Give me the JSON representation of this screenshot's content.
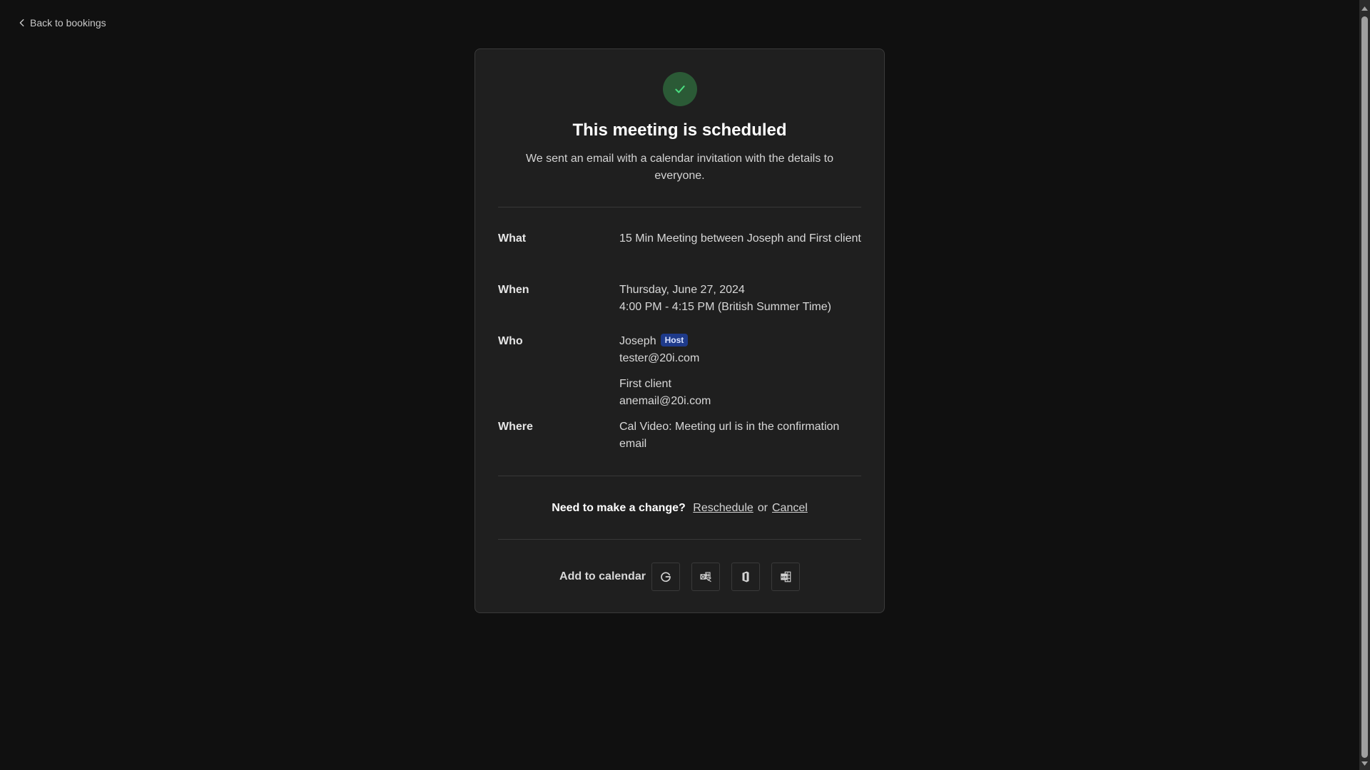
{
  "nav": {
    "back_label": "Back to bookings"
  },
  "card": {
    "status_icon": "check-icon",
    "title": "This meeting is scheduled",
    "subtitle": "We sent an email with a calendar invitation with the details to everyone.",
    "details": {
      "what": {
        "label": "What",
        "value": "15 Min Meeting between Joseph and First client"
      },
      "when": {
        "label": "When",
        "date": "Thursday, June 27, 2024",
        "time": "4:00 PM - 4:15 PM (British Summer Time)"
      },
      "who": {
        "label": "Who",
        "host": {
          "name": "Joseph",
          "badge": "Host",
          "email": "tester@20i.com"
        },
        "attendee": {
          "name": "First client",
          "email": "anemail@20i.com"
        }
      },
      "where": {
        "label": "Where",
        "value": "Cal Video: Meeting url is in the confirmation email"
      }
    },
    "change": {
      "question": "Need to make a change?",
      "reschedule": "Reschedule",
      "or": "or",
      "cancel": "Cancel"
    },
    "add_to_calendar": {
      "label": "Add to calendar",
      "buttons": [
        {
          "name": "Google Calendar",
          "icon": "google-icon"
        },
        {
          "name": "Outlook",
          "icon": "outlook-icon"
        },
        {
          "name": "Office 365",
          "icon": "office-icon"
        },
        {
          "name": "ICS download",
          "icon": "ics-file-icon"
        }
      ]
    }
  },
  "colors": {
    "page_bg": "#101010",
    "card_bg": "#1f1f1f",
    "success_circle": "#2b5a36",
    "success_check": "#4ade80",
    "host_badge_bg": "#1e3a8a"
  }
}
